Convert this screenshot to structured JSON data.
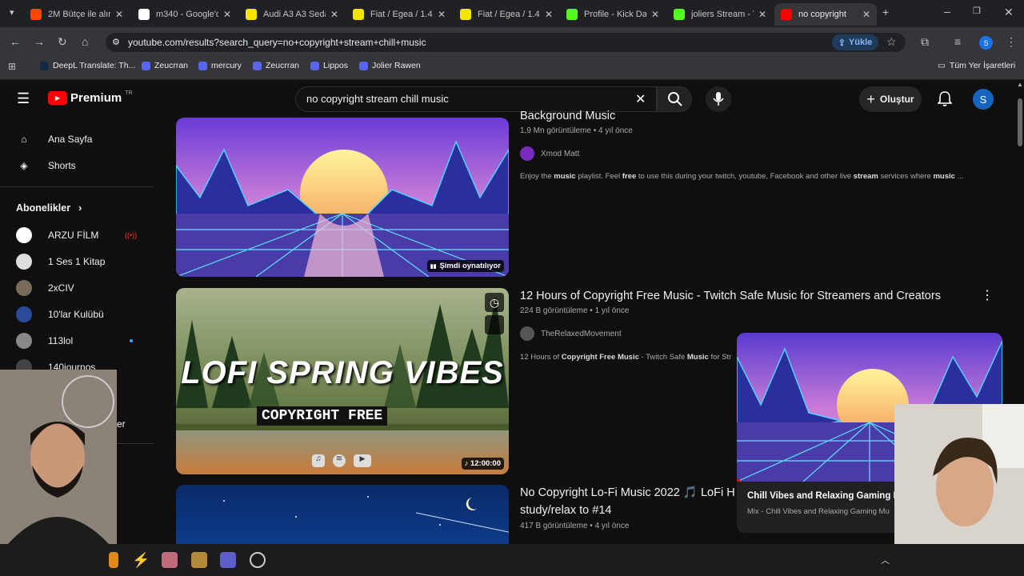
{
  "browser": {
    "tabs": [
      {
        "label": "2M Bütçe ile alın",
        "favicon_color": "#ff4500",
        "active": false
      },
      {
        "label": "m340 - Google'd",
        "favicon_color": "#ffffff",
        "active": false
      },
      {
        "label": "Audi A3 A3 Sedan",
        "favicon_color": "#f5e400",
        "active": false
      },
      {
        "label": "Fiat / Egea / 1.4",
        "favicon_color": "#f5e400",
        "active": false
      },
      {
        "label": "Fiat / Egea / 1.4",
        "favicon_color": "#f5e400",
        "active": false
      },
      {
        "label": "Profile - Kick Da",
        "favicon_color": "#53fc18",
        "active": false
      },
      {
        "label": "joliers Stream - V",
        "favicon_color": "#53fc18",
        "active": false
      },
      {
        "label": "no copyright",
        "favicon_color": "#ff0000",
        "active": true
      }
    ],
    "url": "youtube.com/results?search_query=no+copyright+stream+chill+music",
    "upload_label": "Yükle",
    "bookmarks": [
      {
        "label": "DeepL Translate: Th...",
        "color": "#0f2b46"
      },
      {
        "label": "Zeucrran",
        "color": "#5865f2"
      },
      {
        "label": "mercury",
        "color": "#5865f2"
      },
      {
        "label": "Zeucrran",
        "color": "#5865f2"
      },
      {
        "label": "Lippos",
        "color": "#5865f2"
      },
      {
        "label": "Jolier Rawen",
        "color": "#5865f2"
      }
    ],
    "all_bookmarks_label": "Tüm Yer İşaretleri",
    "profile_initial": "S"
  },
  "youtube": {
    "logo_text": "Premium",
    "logo_region": "TR",
    "search_value": "no copyright stream chill music",
    "create_label": "Oluştur",
    "avatar_initial": "S",
    "sidebar": {
      "home": "Ana Sayfa",
      "shorts": "Shorts",
      "subscriptions_heading": "Abonelikler",
      "subscriptions": [
        {
          "name": "ARZU FİLM",
          "color": "#ffffff",
          "live": true
        },
        {
          "name": "1 Ses 1 Kitap",
          "color": "#dddddd",
          "live": false
        },
        {
          "name": "2xCIV",
          "color": "#7a6a5a",
          "live": false
        },
        {
          "name": "10'lar Kulübü",
          "color": "#2a4a9a",
          "live": false
        },
        {
          "name": "113lol",
          "color": "#888888",
          "live": false,
          "dot": true
        },
        {
          "name": "140journos",
          "color": "#444444",
          "live": false
        }
      ],
      "partial_label": "er"
    },
    "videos": [
      {
        "title": "Background Music",
        "views": "1,9 Mn görüntüleme",
        "age": "4 yıl önce",
        "channel": "Xmod Matt",
        "description_parts": [
          "Enjoy the ",
          "music",
          " playlist. Feel ",
          "free",
          " to use this during your twitch, youtube, Facebook and other live ",
          "stream",
          " services where ",
          "music",
          " ..."
        ],
        "badge": "Şimdi oynatılıyor"
      },
      {
        "title": "12 Hours of Copyright Free Music - Twitch Safe Music for Streamers and Creators",
        "views": "224 B görüntüleme",
        "age": "1 yıl önce",
        "channel": "TheRelaxedMovement",
        "description_parts": [
          "12 Hours of ",
          "Copyright Free Music",
          " - Twitch Safe ",
          "Music",
          " for Str"
        ],
        "thumb_title": "LOFI SPRING VIBES",
        "thumb_subtitle": "COPYRIGHT FREE",
        "badge": "12:00:00"
      },
      {
        "title_line1": "No Copyright Lo-Fi Music 2022 🎵 LoFi H",
        "title_line2": "study/relax to #14",
        "views": "417 B görüntüleme",
        "age": "4 yıl önce"
      }
    ],
    "miniplayer": {
      "title": "Chill Vibes and Relaxing Gaming Mu",
      "subtitle": "Mix - Chill Vibes and Relaxing Gaming Mu"
    }
  }
}
